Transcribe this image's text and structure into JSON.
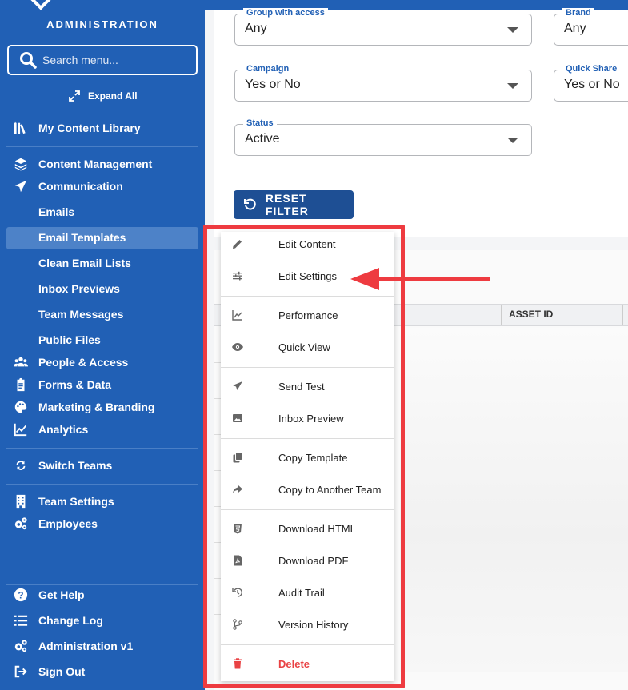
{
  "sidebar": {
    "title": "ADMINISTRATION",
    "search_placeholder": "Search menu...",
    "expand_all": "Expand All",
    "items": {
      "my_content_library": "My Content Library",
      "content_management": "Content Management",
      "communication": "Communication",
      "emails": "Emails",
      "email_templates": "Email Templates",
      "clean_email_lists": "Clean Email Lists",
      "inbox_previews": "Inbox Previews",
      "team_messages": "Team Messages",
      "public_files": "Public Files",
      "people_access": "People & Access",
      "forms_data": "Forms & Data",
      "marketing_branding": "Marketing & Branding",
      "analytics": "Analytics",
      "switch_teams": "Switch Teams",
      "team_settings": "Team Settings",
      "employees": "Employees",
      "get_help": "Get Help",
      "change_log": "Change Log",
      "administration_v1": "Administration v1",
      "sign_out": "Sign Out"
    },
    "active_item": "Email Templates"
  },
  "filters": {
    "group_with_access": {
      "label": "Group with access",
      "value": "Any"
    },
    "brand": {
      "label": "Brand",
      "value": "Any"
    },
    "campaign": {
      "label": "Campaign",
      "value": "Yes or No"
    },
    "quick_share": {
      "label": "Quick Share",
      "value": "Yes or No"
    },
    "status": {
      "label": "Status",
      "value": "Active"
    },
    "reset_label": "RESET FILTER"
  },
  "table": {
    "col_asset_id": "ASSET ID"
  },
  "context_menu": {
    "edit_content": "Edit Content",
    "edit_settings": "Edit Settings",
    "performance": "Performance",
    "quick_view": "Quick View",
    "send_test": "Send Test",
    "inbox_preview": "Inbox Preview",
    "copy_template": "Copy Template",
    "copy_to_another_team": "Copy to Another Team",
    "download_html": "Download HTML",
    "download_pdf": "Download PDF",
    "audit_trail": "Audit Trail",
    "version_history": "Version History",
    "delete": "Delete"
  },
  "colors": {
    "sidebar_bg": "#2160b5",
    "active_bg": "#4d82c8",
    "button_bg": "#1e4f94",
    "highlight": "#ee3b40",
    "delete": "#e94244"
  }
}
